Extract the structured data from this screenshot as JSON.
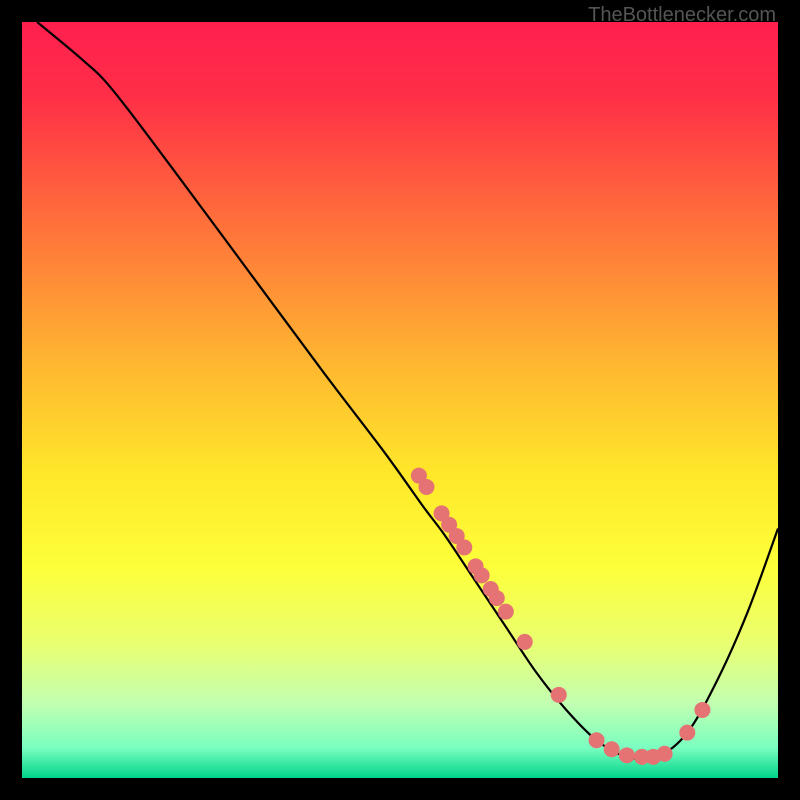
{
  "watermark": "TheBottlenecker.com",
  "chart_data": {
    "type": "line",
    "title": "",
    "xlabel": "",
    "ylabel": "",
    "xlim": [
      0,
      100
    ],
    "ylim": [
      0,
      100
    ],
    "background_gradient": {
      "stops": [
        {
          "pos": 0.0,
          "color": "#ff1f4f"
        },
        {
          "pos": 0.1,
          "color": "#ff2f47"
        },
        {
          "pos": 0.25,
          "color": "#ff6a3c"
        },
        {
          "pos": 0.45,
          "color": "#ffb631"
        },
        {
          "pos": 0.6,
          "color": "#ffe82a"
        },
        {
          "pos": 0.72,
          "color": "#fdff3a"
        },
        {
          "pos": 0.82,
          "color": "#eaff6f"
        },
        {
          "pos": 0.9,
          "color": "#c3ffb0"
        },
        {
          "pos": 0.96,
          "color": "#7affc0"
        },
        {
          "pos": 1.0,
          "color": "#00d48a"
        }
      ]
    },
    "series": [
      {
        "name": "curve",
        "type": "line",
        "points": [
          {
            "x": 2,
            "y": 100
          },
          {
            "x": 8,
            "y": 95
          },
          {
            "x": 12,
            "y": 91
          },
          {
            "x": 20,
            "y": 80.5
          },
          {
            "x": 30,
            "y": 67
          },
          {
            "x": 40,
            "y": 53.5
          },
          {
            "x": 48,
            "y": 43
          },
          {
            "x": 53,
            "y": 36
          },
          {
            "x": 56,
            "y": 32
          },
          {
            "x": 60,
            "y": 26
          },
          {
            "x": 64,
            "y": 20
          },
          {
            "x": 68,
            "y": 14
          },
          {
            "x": 72,
            "y": 9
          },
          {
            "x": 76,
            "y": 5
          },
          {
            "x": 80,
            "y": 2.8
          },
          {
            "x": 84,
            "y": 2.8
          },
          {
            "x": 88,
            "y": 6
          },
          {
            "x": 92,
            "y": 13
          },
          {
            "x": 96,
            "y": 22
          },
          {
            "x": 100,
            "y": 33
          }
        ]
      },
      {
        "name": "dots",
        "type": "scatter",
        "color": "#e57373",
        "points": [
          {
            "x": 52.5,
            "y": 40
          },
          {
            "x": 53.5,
            "y": 38.5
          },
          {
            "x": 55.5,
            "y": 35
          },
          {
            "x": 56.5,
            "y": 33.5
          },
          {
            "x": 57.5,
            "y": 32
          },
          {
            "x": 58.5,
            "y": 30.5
          },
          {
            "x": 60,
            "y": 28
          },
          {
            "x": 60.8,
            "y": 26.8
          },
          {
            "x": 62,
            "y": 25
          },
          {
            "x": 62.8,
            "y": 23.8
          },
          {
            "x": 64,
            "y": 22
          },
          {
            "x": 66.5,
            "y": 18
          },
          {
            "x": 71,
            "y": 11
          },
          {
            "x": 76,
            "y": 5
          },
          {
            "x": 78,
            "y": 3.8
          },
          {
            "x": 80,
            "y": 3
          },
          {
            "x": 82,
            "y": 2.8
          },
          {
            "x": 83.5,
            "y": 2.8
          },
          {
            "x": 85,
            "y": 3.2
          },
          {
            "x": 88,
            "y": 6
          },
          {
            "x": 90,
            "y": 9
          }
        ]
      }
    ]
  }
}
